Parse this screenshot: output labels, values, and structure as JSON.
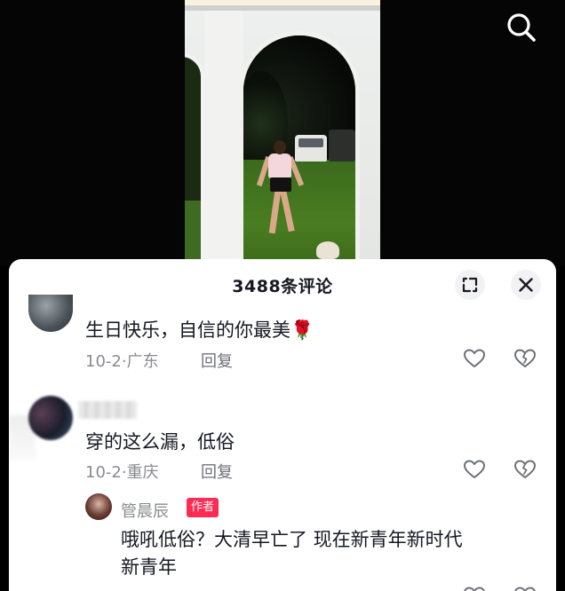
{
  "sheet": {
    "title": "3488条评论"
  },
  "comments": [
    {
      "text": "生日快乐，自信的你最美",
      "emoji": "🌹",
      "date": "10-2",
      "separator": "·",
      "location": "广东",
      "reply_label": "回复"
    },
    {
      "text": "穿的这么漏，低俗",
      "date": "10-2",
      "separator": "·",
      "location": "重庆",
      "reply_label": "回复",
      "replies": [
        {
          "author": "管晨辰",
          "author_tag": "作者",
          "text_line1": "哦吼低俗？大清早亡了 现在新青年新时代",
          "text_line2": "新青年"
        }
      ]
    }
  ],
  "icons": {
    "search": "search-icon",
    "expand": "expand-icon",
    "close": "close-icon",
    "like": "heart-icon",
    "dislike": "broken-heart-icon"
  }
}
